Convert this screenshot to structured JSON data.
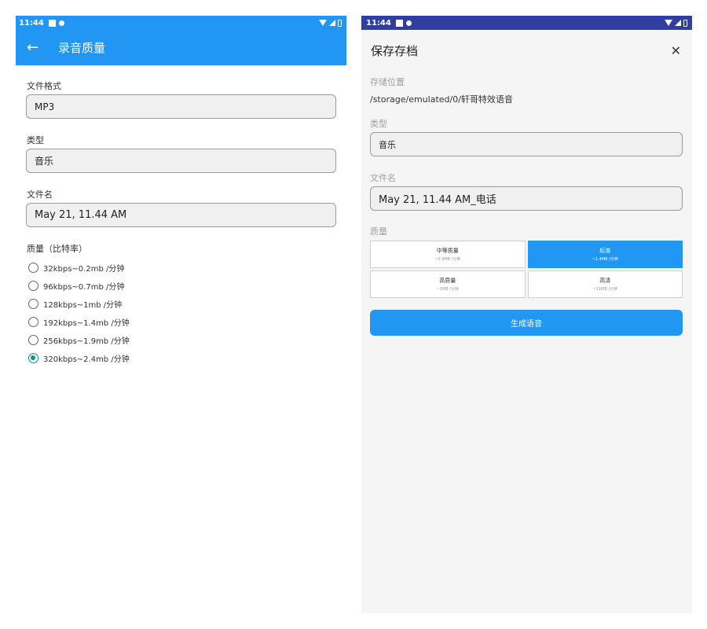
{
  "left": {
    "status": {
      "time": "11:44"
    },
    "appbar": {
      "back_icon": "←",
      "title": "录音质量"
    },
    "format": {
      "label": "文件格式",
      "value": "MP3"
    },
    "type": {
      "label": "类型",
      "value": "音乐"
    },
    "filename": {
      "label": "文件名",
      "value": "May 21, 11.44 AM"
    },
    "quality": {
      "label": "质量（比特率）",
      "options": [
        {
          "label": "32kbps~0.2mb /分钟",
          "checked": false
        },
        {
          "label": "96kbps~0.7mb /分钟",
          "checked": false
        },
        {
          "label": "128kbps~1mb /分钟",
          "checked": false
        },
        {
          "label": "192kbps~1.4mb /分钟",
          "checked": false
        },
        {
          "label": "256kbps~1.9mb /分钟",
          "checked": false
        },
        {
          "label": "320kbps~2.4mb /分钟",
          "checked": true
        }
      ]
    }
  },
  "right": {
    "status": {
      "time": "11:44"
    },
    "dialog": {
      "title": "保存存档",
      "close_icon": "✕"
    },
    "location": {
      "label": "存储位置",
      "path": "/storage/emulated/0/轩哥特效语音"
    },
    "type": {
      "label": "类型",
      "value": "音乐"
    },
    "filename": {
      "label": "文件名",
      "value": "May 21, 11.44 AM_电话"
    },
    "quality": {
      "label": "质量",
      "options": [
        {
          "title": "中等质量",
          "sub": "~0.9MB /分钟",
          "active": false
        },
        {
          "title": "标准",
          "sub": "~1.4MB /分钟",
          "active": true
        },
        {
          "title": "高质量",
          "sub": "~2MB /分钟",
          "active": false
        },
        {
          "title": "高清",
          "sub": "~11MB /分钟",
          "active": false
        }
      ]
    },
    "generate_button": "生成语音"
  },
  "colors": {
    "primary": "#2196F3",
    "status_dark": "#303F9F",
    "radio_checked": "#009688"
  }
}
